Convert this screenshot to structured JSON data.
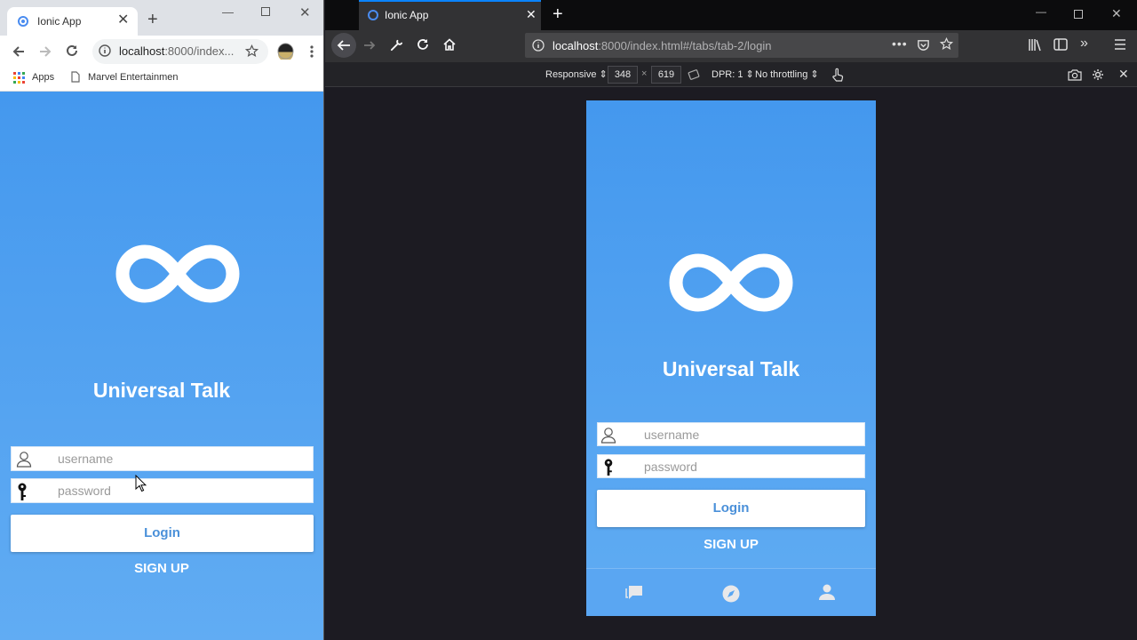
{
  "chrome": {
    "tab_title": "Ionic App",
    "url_host": "localhost",
    "url_rest": ":8000/index...",
    "bookmarks": [
      {
        "label": "Apps",
        "icon": "apps-grid-icon"
      },
      {
        "label": "Marvel Entertainmen",
        "icon": "page-icon"
      }
    ]
  },
  "firefox": {
    "tab_title": "Ionic App",
    "url_host": "localhost",
    "url_rest": ":8000/index.html#/tabs/tab-2/login",
    "rdm": {
      "device": "Responsive",
      "width": "348",
      "separator": "×",
      "height": "619",
      "dpr": "DPR: 1",
      "throttling": "No throttling"
    }
  },
  "app": {
    "title": "Universal Talk",
    "username_placeholder": "username",
    "password_placeholder": "password",
    "login_label": "Login",
    "signup_label": "SIGN UP",
    "tabs": [
      {
        "icon": "chat-icon"
      },
      {
        "icon": "compass-icon"
      },
      {
        "icon": "person-icon"
      }
    ]
  },
  "colors": {
    "app_gradient_top": "#4498ee",
    "app_gradient_bottom": "#61acf3",
    "login_text": "#4a90d9",
    "firefox_accent": "#0a84ff"
  }
}
